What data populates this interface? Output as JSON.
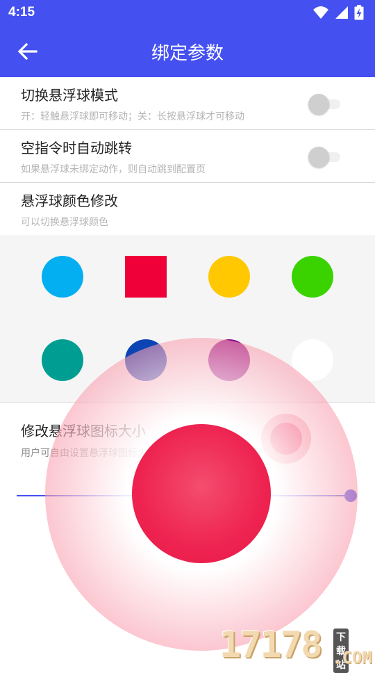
{
  "status_bar": {
    "time": "4:15"
  },
  "app_bar": {
    "title": "绑定参数"
  },
  "settings": [
    {
      "label": "切换悬浮球模式",
      "description": "开：轻触悬浮球即可移动；关：长按悬浮球才可移动",
      "toggle_on": false
    },
    {
      "label": "空指令时自动跳转",
      "description": "如果悬浮球未绑定动作，则自动跳到配置页",
      "toggle_on": false
    },
    {
      "label": "悬浮球颜色修改",
      "description": "可以切换悬浮球颜色"
    }
  ],
  "palette": {
    "colors": [
      "#03aef1",
      "#ef0038",
      "#ffc800",
      "#3ad300",
      "#009e92",
      "#0d44b5",
      "#8a0c8c",
      "#ffffff"
    ],
    "selected_index": 1
  },
  "icon_size": {
    "label": "修改悬浮球图标大小",
    "description": "用户可自由设置悬浮球图标大小",
    "value_fraction": 0.98
  },
  "floating_ball": {
    "color": "#ee2350"
  },
  "watermark": {
    "number": "17178",
    "tag": "下载站",
    "domain": ".COM"
  }
}
